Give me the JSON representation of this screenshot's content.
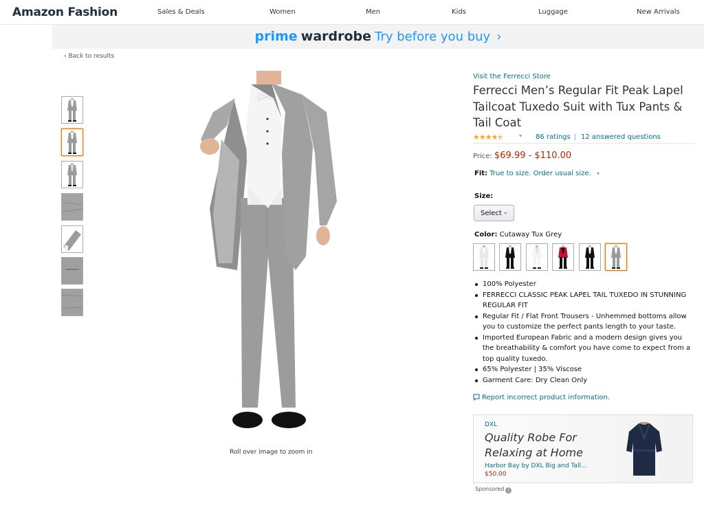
{
  "nav": {
    "brand": "Amazon Fashion",
    "links": [
      "Sales & Deals",
      "Women",
      "Men",
      "Kids",
      "Luggage",
      "New Arrivals"
    ]
  },
  "banner": {
    "prime": "prime",
    "wardrobe": "wardrobe",
    "cta": "Try before you buy",
    "chevron": "›"
  },
  "back_link": "‹ Back to results",
  "gallery": {
    "thumbnail_count": 7,
    "active_thumbnail": 2,
    "zoom_hint": "Roll over image to zoom in"
  },
  "product": {
    "store_link": "Visit the Ferrecci Store",
    "title": "Ferrecci Men’s Regular Fit Peak Lapel Tailcoat Tuxedo Suit with Tux Pants & Tail Coat",
    "rating_stars": 4.5,
    "ratings_count": "86 ratings",
    "separator": "|",
    "answered": "12 answered questions",
    "price_label": "Price:",
    "price": "$69.99 - $110.00",
    "fit_label": "Fit:",
    "fit_value": "True to size. Order usual size.",
    "size_label": "Size:",
    "size_select": "Select",
    "color_label": "Color:",
    "color_value": "Cutaway Tux Grey",
    "swatch_count": 6,
    "active_swatch": 6,
    "bullets": [
      "100% Polyester",
      "FERRECCI CLASSIC PEAK LAPEL TAIL TUXEDO IN STUNNING REGULAR FIT",
      "Regular Fit / Flat Front Trousers - Unhemmed bottoms allow you to customize the perfect pants length to your taste.",
      "Imported European Fabric and a modern design gives you the breathability & comfort you have come to expect from a top quality tuxedo.",
      "65% Polyester | 35% Viscose",
      "Garment Care: Dry Clean Only"
    ],
    "report_link": "Report incorrect product information."
  },
  "ad": {
    "brand": "DXL",
    "headline": "Quality Robe For Relaxing at Home",
    "product": "Harbor Bay by DXL Big and Tall...",
    "price": "$50.00",
    "sponsored": "Sponsored"
  },
  "colors": {
    "link": "#007185",
    "price": "#b12704",
    "star": "#ffa41c",
    "active_border": "#e77600",
    "prime_blue": "#1a98ff",
    "suit_grey": "#9a9a9a"
  }
}
